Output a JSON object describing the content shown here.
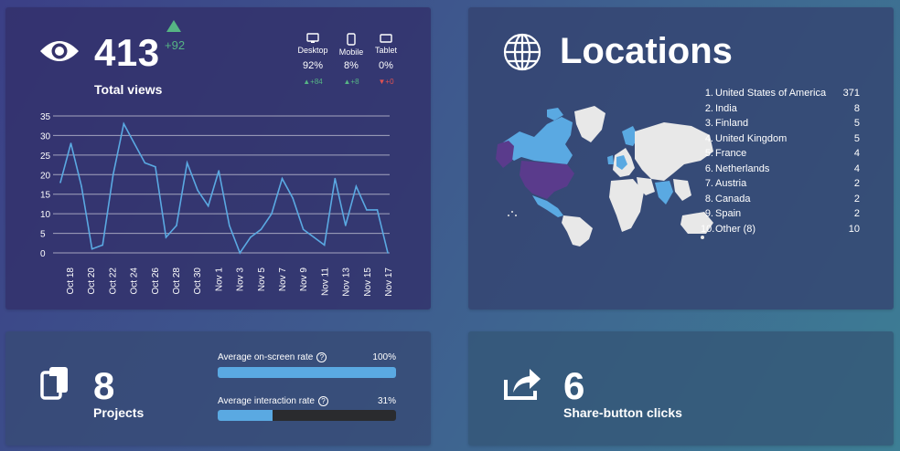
{
  "views": {
    "icon": "eye-icon",
    "count": "413",
    "delta": "+92",
    "label": "Total views",
    "devices": [
      {
        "name": "Desktop",
        "icon": "desktop-icon",
        "pct": "92%",
        "delta": "+84",
        "trend": "up"
      },
      {
        "name": "Mobile",
        "icon": "mobile-icon",
        "pct": "8%",
        "delta": "+8",
        "trend": "up"
      },
      {
        "name": "Tablet",
        "icon": "tablet-icon",
        "pct": "0%",
        "delta": "+0",
        "trend": "down"
      }
    ],
    "colors": {
      "up": "#56b584",
      "down": "#e05252",
      "line": "#5aa9e2"
    }
  },
  "chart_data": {
    "type": "line",
    "x": [
      "Oct 18",
      "Oct 19",
      "Oct 20",
      "Oct 21",
      "Oct 22",
      "Oct 23",
      "Oct 24",
      "Oct 25",
      "Oct 26",
      "Oct 27",
      "Oct 28",
      "Oct 29",
      "Oct 30",
      "Oct 31",
      "Nov 1",
      "Nov 2",
      "Nov 3",
      "Nov 4",
      "Nov 5",
      "Nov 6",
      "Nov 7",
      "Nov 8",
      "Nov 9",
      "Nov 10",
      "Nov 11",
      "Nov 12",
      "Nov 13",
      "Nov 14",
      "Nov 15",
      "Nov 16",
      "Nov 17"
    ],
    "xticks": [
      "Oct 18",
      "Oct 20",
      "Oct 22",
      "Oct 24",
      "Oct 26",
      "Oct 28",
      "Oct 30",
      "Nov 1",
      "Nov 3",
      "Nov 5",
      "Nov 7",
      "Nov 9",
      "Nov 11",
      "Nov 13",
      "Nov 15",
      "Nov 17"
    ],
    "series": [
      {
        "values": [
          18,
          28,
          17,
          1,
          2,
          20,
          33,
          28,
          23,
          22,
          4,
          7,
          23,
          16,
          12,
          21,
          7,
          0,
          4,
          6,
          10,
          19,
          14,
          6,
          4,
          2,
          19,
          7,
          17,
          11,
          11,
          0
        ]
      }
    ],
    "yticks": [
      "0",
      "5",
      "10",
      "15",
      "20",
      "25",
      "30",
      "35"
    ],
    "ylim": [
      0,
      35
    ],
    "grid": true
  },
  "locations": {
    "title": "Locations",
    "icon": "globe-icon",
    "items": [
      {
        "rank": "1.",
        "name": "United States of America",
        "count": "371"
      },
      {
        "rank": "2.",
        "name": "India",
        "count": "8"
      },
      {
        "rank": "3.",
        "name": "Finland",
        "count": "5"
      },
      {
        "rank": "4.",
        "name": "United Kingdom",
        "count": "5"
      },
      {
        "rank": "5.",
        "name": "France",
        "count": "4"
      },
      {
        "rank": "6.",
        "name": "Netherlands",
        "count": "4"
      },
      {
        "rank": "7.",
        "name": "Austria",
        "count": "2"
      },
      {
        "rank": "8.",
        "name": "Canada",
        "count": "2"
      },
      {
        "rank": "9.",
        "name": "Spain",
        "count": "2"
      },
      {
        "rank": "10.",
        "name": "Other (8)",
        "count": "10"
      }
    ],
    "map_colors": {
      "base": "#e8e8e8",
      "low": "#5aa9e2",
      "high": "#5a3b8c"
    }
  },
  "projects": {
    "icon": "copy-icon",
    "count": "8",
    "label": "Projects",
    "onscreen_label": "Average on-screen rate",
    "onscreen_value": "100%",
    "onscreen_fraction": 1.0,
    "interaction_label": "Average interaction rate",
    "interaction_value": "31%",
    "interaction_fraction": 0.31,
    "help_glyph": "?"
  },
  "share": {
    "icon": "share-icon",
    "count": "6",
    "label": "Share-button clicks"
  }
}
